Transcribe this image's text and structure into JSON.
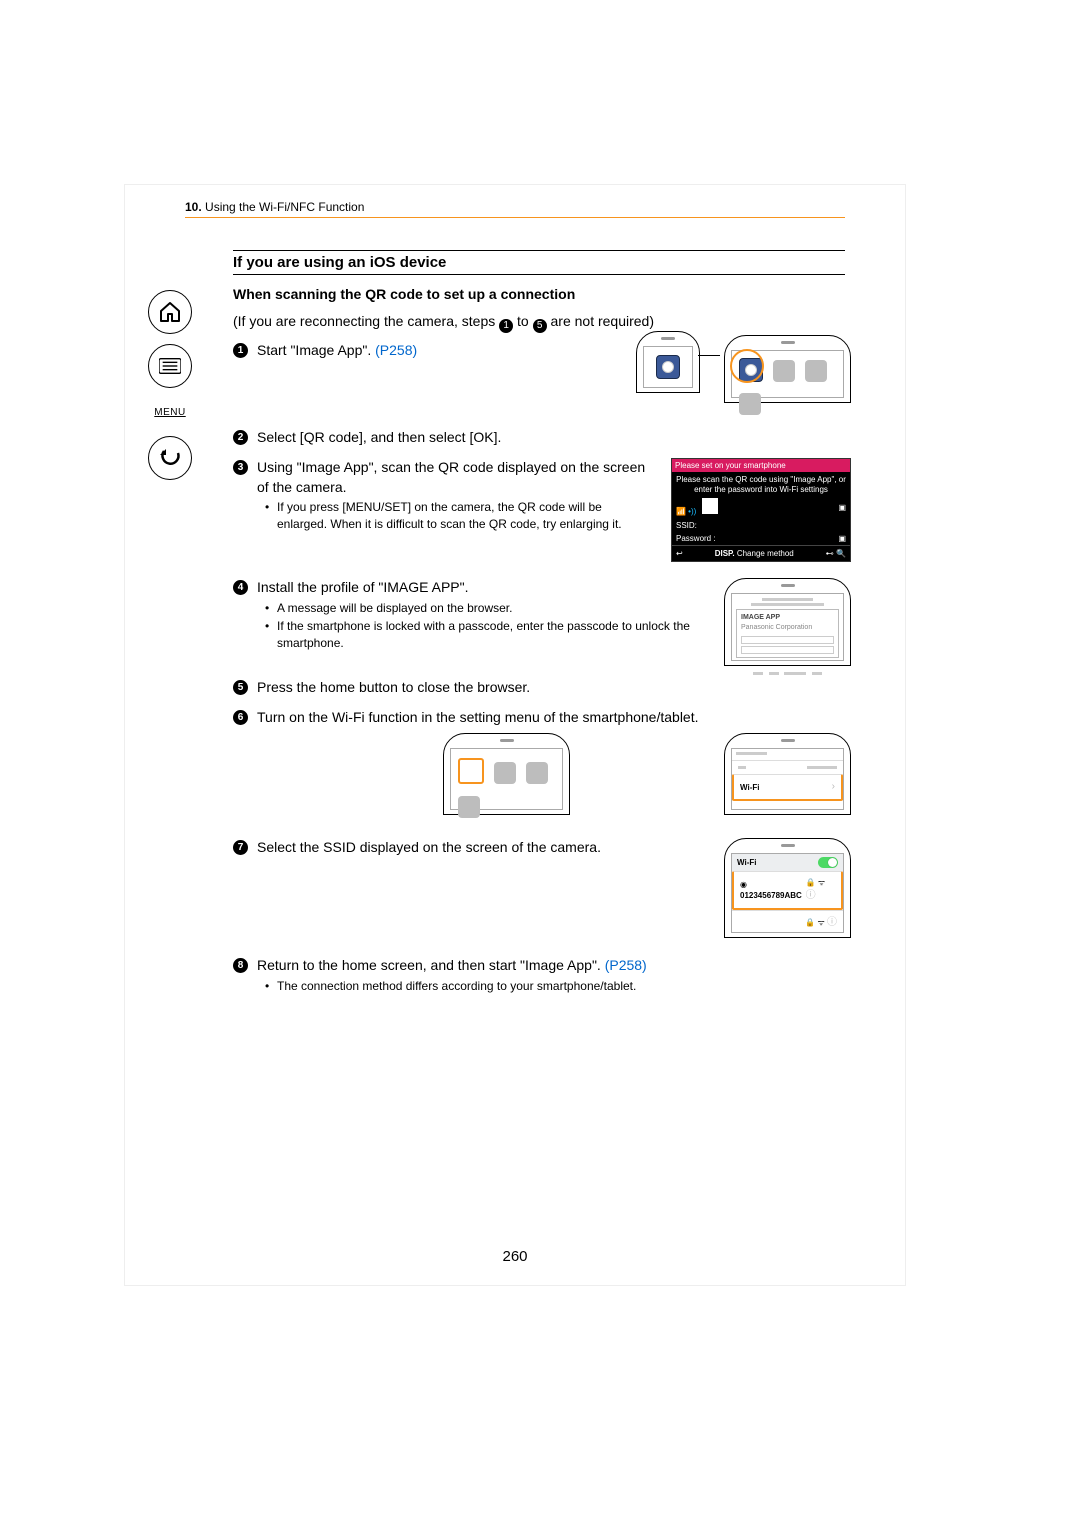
{
  "chapter_num": "10.",
  "chapter_title": "Using the Wi-Fi/NFC Function",
  "section_title": "If you are using an iOS device",
  "sub_heading": "When scanning the QR code to set up a connection",
  "reconnect_prefix": "(If you are reconnecting the camera, steps ",
  "reconnect_mid": " to ",
  "reconnect_suffix": " are not required)",
  "sidenav_menu": "MENU",
  "page_number": "260",
  "pageref": "(P258)",
  "steps": [
    {
      "text_a": "Start \"Image App\". ",
      "link": "(P258)"
    },
    {
      "text_a": "Select [QR code], and then select [OK]."
    },
    {
      "text_a": "Using \"Image App\", scan the QR code displayed on the screen of the camera.",
      "subs": [
        "If you press [MENU/SET] on the camera, the QR code will be enlarged. When it is difficult to scan the QR code, try enlarging it."
      ]
    },
    {
      "text_a": "Install the profile of \"IMAGE APP\".",
      "subs": [
        "A message will be displayed on the browser.",
        "If the smartphone is locked with a passcode, enter the passcode to unlock the smartphone."
      ]
    },
    {
      "text_a": "Press the home button to close the browser."
    },
    {
      "text_a": "Turn on the Wi-Fi function in the setting menu of the smartphone/tablet."
    },
    {
      "text_a": "Select the SSID displayed on the screen of the camera."
    },
    {
      "text_a": "Return to the home screen, and then start \"Image App\". ",
      "link": "(P258)",
      "subs": [
        "The connection method differs according to your smartphone/tablet."
      ]
    }
  ],
  "cam": {
    "topbar": "Please set on your smartphone",
    "msg": "Please scan the QR code using \"Image App\", or enter the password into Wi-Fi settings",
    "ssid_label": "SSID:",
    "pwd_label": "Password :",
    "change": "Change method",
    "disp": "DISP."
  },
  "profile": {
    "title": "IMAGE APP",
    "sub": "Panasonic Corporation"
  },
  "settings": {
    "wifi": "Wi-Fi",
    "ssid": "0123456789ABC"
  }
}
